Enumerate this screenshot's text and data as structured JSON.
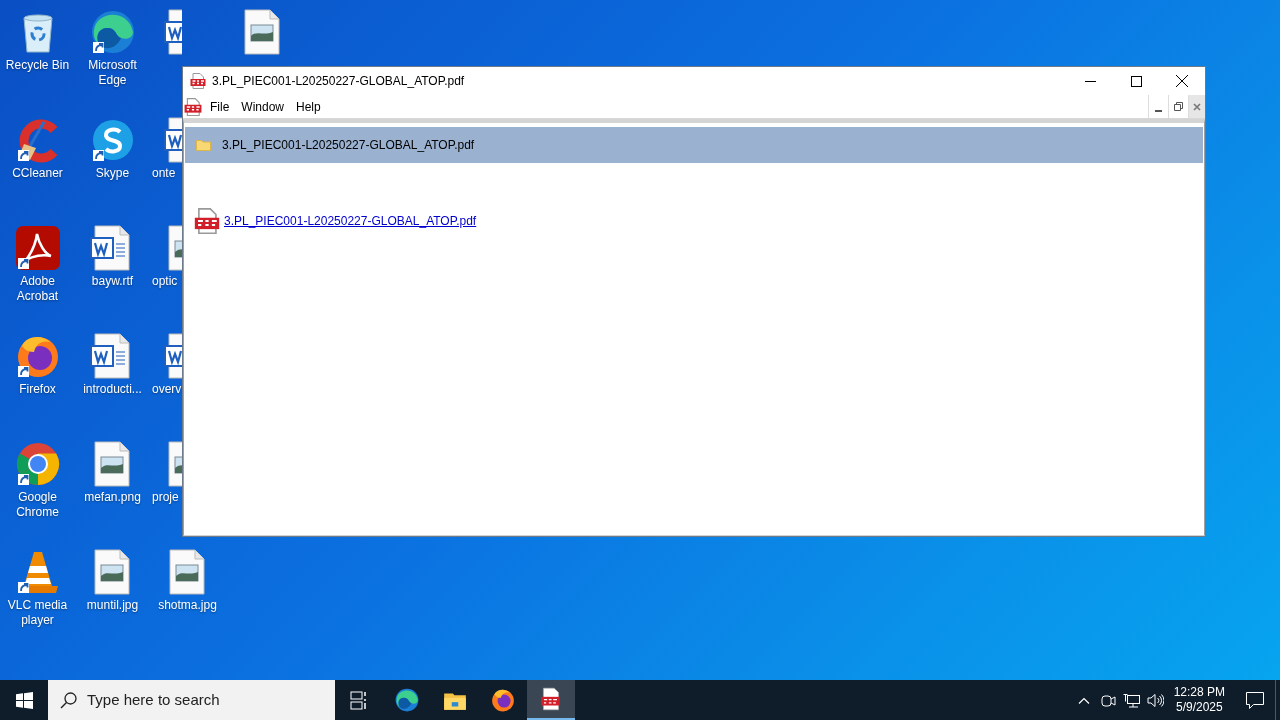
{
  "desktop_icons": [
    {
      "label": "Recycle Bin",
      "kind": "recycle",
      "shortcut": false,
      "partly_hidden": false
    },
    {
      "label": "CCleaner",
      "kind": "ccleaner",
      "shortcut": true,
      "partly_hidden": false
    },
    {
      "label": "Adobe Acrobat",
      "kind": "acrobat",
      "shortcut": true,
      "partly_hidden": false
    },
    {
      "label": "Firefox",
      "kind": "firefox",
      "shortcut": true,
      "partly_hidden": false
    },
    {
      "label": "Google Chrome",
      "kind": "chrome",
      "shortcut": true,
      "partly_hidden": false
    },
    {
      "label": "VLC media player",
      "kind": "vlc",
      "shortcut": true,
      "partly_hidden": false
    },
    {
      "label": "Microsoft Edge",
      "kind": "edge",
      "shortcut": true,
      "partly_hidden": false
    },
    {
      "label": "Skype",
      "kind": "skype",
      "shortcut": true,
      "partly_hidden": false
    },
    {
      "label": "bayw.rtf",
      "kind": "word",
      "shortcut": false,
      "partly_hidden": false
    },
    {
      "label": "introducti...",
      "kind": "word",
      "shortcut": false,
      "partly_hidden": false
    },
    {
      "label": "mefan.png",
      "kind": "image",
      "shortcut": false,
      "partly_hidden": false
    },
    {
      "label": "muntil.jpg",
      "kind": "image",
      "shortcut": false,
      "partly_hidden": false
    },
    {
      "kind": "word",
      "shortcut": false,
      "partly_hidden": true
    },
    {
      "label": "onte",
      "kind": "word",
      "shortcut": false,
      "partly_hidden": true
    },
    {
      "label": "optic",
      "kind": "image",
      "shortcut": false,
      "partly_hidden": true
    },
    {
      "label": "overv",
      "kind": "word",
      "shortcut": false,
      "partly_hidden": true
    },
    {
      "label": "proje",
      "kind": "image",
      "shortcut": false,
      "partly_hidden": true
    },
    {
      "label": "shotma.jpg",
      "kind": "image",
      "shortcut": false,
      "partly_hidden": false
    },
    {
      "kind": "image",
      "shortcut": false,
      "partly_hidden": false
    }
  ],
  "window": {
    "title": "3.PL_PIEC001-L20250227-GLOBAL_ATOP.pdf",
    "menu": [
      "File",
      "Window",
      "Help"
    ],
    "tree_item": {
      "label": "3.PL_PIEC001-L20250227-GLOBAL_ATOP.pdf",
      "selected": true
    },
    "link": "3.PL_PIEC001-L20250227-GLOBAL_ATOP.pdf"
  },
  "taskbar": {
    "search_placeholder": "Type here to search",
    "apps": [
      {
        "kind": "taskview",
        "selected": false
      },
      {
        "kind": "edge",
        "selected": false
      },
      {
        "kind": "explorer",
        "selected": false
      },
      {
        "kind": "firefox",
        "selected": false
      },
      {
        "kind": "pdf",
        "selected": true
      }
    ],
    "time": "12:28 PM",
    "date": "5/9/2025"
  }
}
